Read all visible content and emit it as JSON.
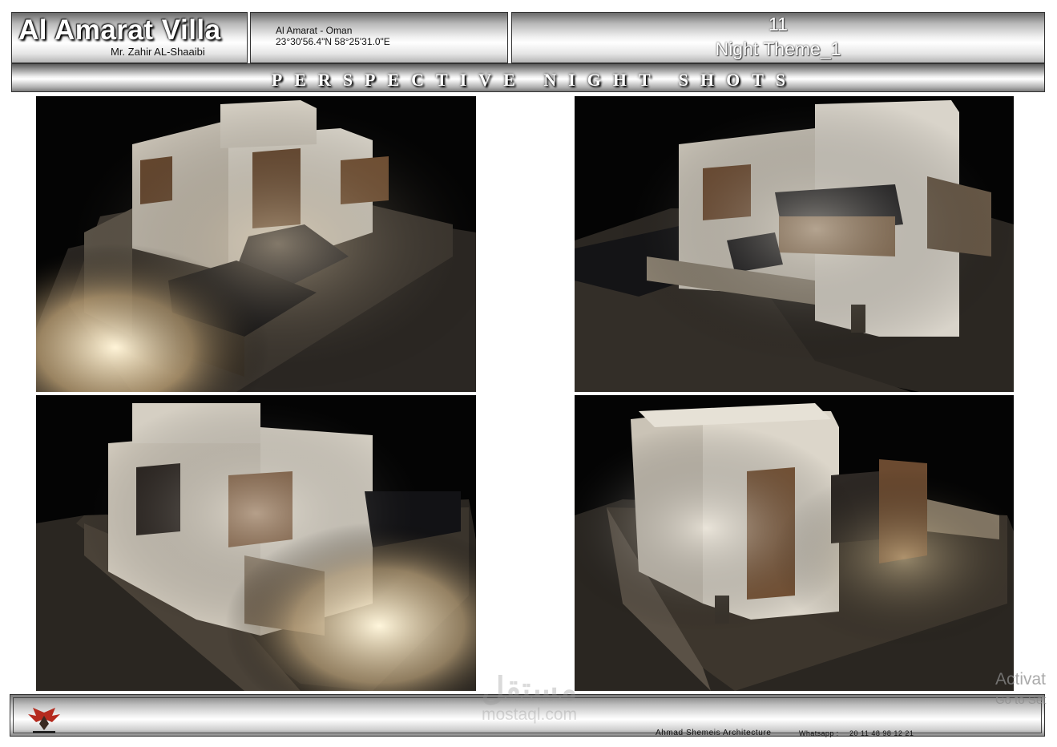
{
  "header": {
    "project_title": "Al Amarat Villa",
    "client_name": "Mr. Zahir AL-Shaaibi",
    "location_name": "Al Amarat - Oman",
    "coordinates": "23°30'56.4\"N 58°25'31.0\"E",
    "sheet_number": "11",
    "sheet_title": "Night Theme_1",
    "banner": "PERSPECTIVE NIGHT SHOTS"
  },
  "renders": [
    {
      "view": "night-perspective-front-left"
    },
    {
      "view": "night-perspective-rear-right"
    },
    {
      "view": "night-perspective-front-right"
    },
    {
      "view": "night-perspective-side"
    }
  ],
  "footer": {
    "logo_icon": "eagle-logo-icon",
    "office_name": "Ahmad Shemeis Architecture",
    "whatsapp_label": "Whatsapp :",
    "whatsapp_number": "20 11 48 98 12 21"
  },
  "overlays": {
    "watermark_arabic": "مستقل",
    "watermark_latin": "mostaql.com",
    "os_notice_line1": "Activat",
    "os_notice_line2": "Go to Set"
  }
}
